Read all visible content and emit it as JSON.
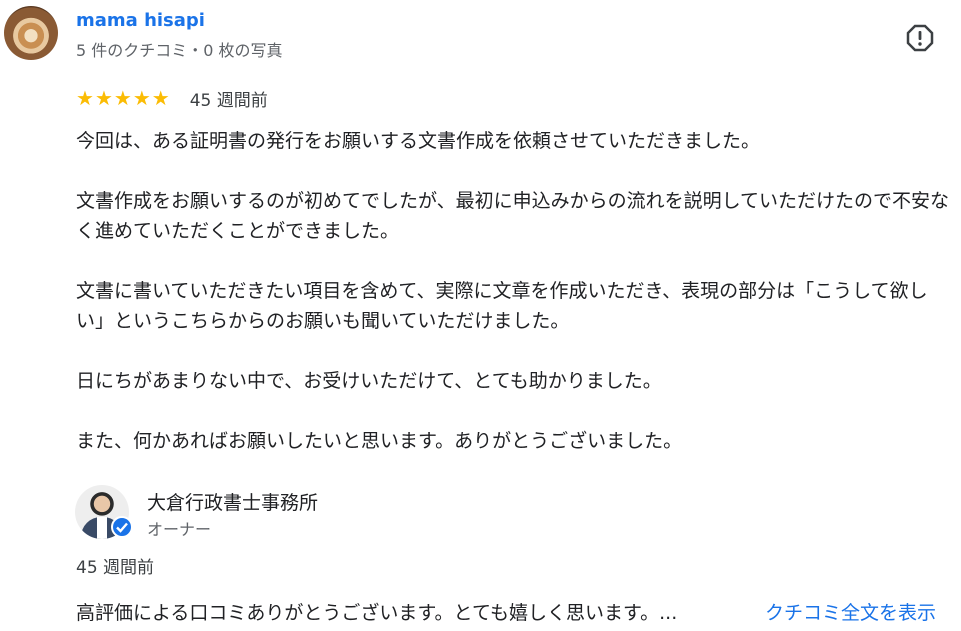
{
  "reviewer": {
    "name": "mama hisapi",
    "meta": "5 件のクチコミ・0 枚の写真",
    "avatar_icon": "latte-art-avatar"
  },
  "report_icon": "report-flag-icon",
  "review": {
    "rating": 5,
    "stars": [
      "★",
      "★",
      "★",
      "★",
      "★"
    ],
    "time": "45 週間前",
    "paragraphs": [
      "今回は、ある証明書の発行をお願いする文書作成を依頼させていただきました。",
      "文書作成をお願いするのが初めてでしたが、最初に申込みからの流れを説明していただけたので不安なく進めていただくことができました。",
      "文書に書いていただきたい項目を含めて、実際に文章を作成いただき、表現の部分は「こうして欲しい」というこちらからのお願いも聞いていただけました。",
      "日にちがあまりない中で、お受けいただけて、とても助かりました。",
      "また、何かあればお願いしたいと思います。ありがとうございました。"
    ]
  },
  "owner_reply": {
    "name": "大倉行政書士事務所",
    "role": "オーナー",
    "time": "45 週間前",
    "text": "高評価による口コミありがとうございます。とても嬉しく思います。...",
    "read_more": "クチコミ全文を表示"
  },
  "colors": {
    "link": "#1a73e8",
    "star": "#fbbc04",
    "secondary_text": "#5f6368"
  }
}
